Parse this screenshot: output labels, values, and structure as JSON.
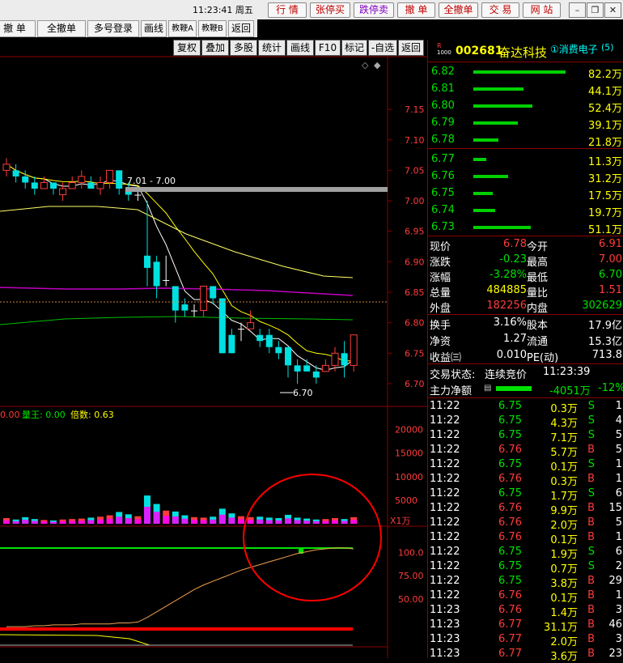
{
  "topbar": {
    "clock": "11:23:41 周五",
    "buttons": [
      "行 情",
      "张停买",
      "跌停卖",
      "撤 单",
      "全撤单",
      "交 易",
      "网 站"
    ],
    "window_controls": [
      "minimize",
      "restore",
      "close"
    ]
  },
  "toolbar1": [
    "撤 单",
    "全撤单",
    "多号登录",
    "画线",
    "教鞭A",
    "教鞭B",
    "返回"
  ],
  "toolbar2": [
    "复权",
    "叠加",
    "多股",
    "统计",
    "画线",
    "F10",
    "标记",
    "-自选",
    "返回"
  ],
  "colors": {
    "up": "#ff3b3b",
    "down": "#00e000",
    "accent_bg": "#000000",
    "frame": "#8b0000"
  },
  "stock": {
    "badge_top": "R",
    "badge_bottom": "1000",
    "code": "002681",
    "name": "奋达科技",
    "concept": "①消费电子",
    "concept_count": "(5)"
  },
  "price_axis": [
    "7.15",
    "7.10",
    "7.05",
    "7.00",
    "6.95",
    "6.90",
    "6.85",
    "6.80",
    "6.75",
    "6.70"
  ],
  "annot_range": "7.01 - 7.00",
  "annot_low": "6.70",
  "volume_label": {
    "prefix": "0.00",
    "v1_label": "量王: 0.00",
    "v2_label": "倍数: 0.63"
  },
  "volume_axis": [
    "20000",
    "15000",
    "10000",
    "5000",
    "X1万"
  ],
  "indicator_axis": [
    "100.0",
    "75.00",
    "50.00"
  ],
  "asks": [
    {
      "price": "6.82",
      "vol": "82.2万",
      "bar": 1.0
    },
    {
      "price": "6.81",
      "vol": "44.1万",
      "bar": 0.54
    },
    {
      "price": "6.80",
      "vol": "52.4万",
      "bar": 0.64
    },
    {
      "price": "6.79",
      "vol": "39.1万",
      "bar": 0.48
    },
    {
      "price": "6.78",
      "vol": "21.8万",
      "bar": 0.27
    }
  ],
  "bids": [
    {
      "price": "6.77",
      "vol": "11.3万",
      "bar": 0.14
    },
    {
      "price": "6.76",
      "vol": "31.2万",
      "bar": 0.38
    },
    {
      "price": "6.75",
      "vol": "17.5万",
      "bar": 0.21
    },
    {
      "price": "6.74",
      "vol": "19.7万",
      "bar": 0.24
    },
    {
      "price": "6.73",
      "vol": "51.1万",
      "bar": 0.62
    }
  ],
  "quote": [
    {
      "l1": "现价",
      "v1": "6.78",
      "c1": "red",
      "l2": "今开",
      "v2": "6.91",
      "c2": "red"
    },
    {
      "l1": "涨跌",
      "v1": "-0.23",
      "c1": "green",
      "l2": "最高",
      "v2": "7.00",
      "c2": "red"
    },
    {
      "l1": "涨幅",
      "v1": "-3.28%",
      "c1": "green",
      "l2": "最低",
      "v2": "6.70",
      "c2": "green"
    },
    {
      "l1": "总量",
      "v1": "484885",
      "c1": "yellow",
      "l2": "量比",
      "v2": "1.51",
      "c2": "red"
    },
    {
      "l1": "外盘",
      "v1": "182256",
      "c1": "red",
      "l2": "内盘",
      "v2": "302629",
      "c2": "green"
    }
  ],
  "fund": [
    {
      "l1": "换手",
      "v1": "3.16%",
      "l2": "股本",
      "v2": "17.9亿"
    },
    {
      "l1": "净资",
      "v1": "1.27",
      "l2": "流通",
      "v2": "15.3亿"
    },
    {
      "l1": "收益㈢",
      "v1": "0.010",
      "l2": "PE(动)",
      "v2": "713.8"
    }
  ],
  "trade_status": {
    "label": "交易状态:",
    "value": "连续竞价",
    "time": "11:23:39"
  },
  "main_flow": {
    "label": "主力净额",
    "value": "-4051万",
    "pct": "-12%"
  },
  "ticks": [
    {
      "t": "11:22",
      "p": "6.75",
      "v": "0.3万",
      "s": "S",
      "n": "1"
    },
    {
      "t": "11:22",
      "p": "6.75",
      "v": "4.3万",
      "s": "S",
      "n": "4"
    },
    {
      "t": "11:22",
      "p": "6.75",
      "v": "7.1万",
      "s": "S",
      "n": "5"
    },
    {
      "t": "11:22",
      "p": "6.76",
      "v": "5.7万",
      "s": "B",
      "n": "5"
    },
    {
      "t": "11:22",
      "p": "6.75",
      "v": "0.1万",
      "s": "S",
      "n": "1"
    },
    {
      "t": "11:22",
      "p": "6.76",
      "v": "0.3万",
      "s": "B",
      "n": "1"
    },
    {
      "t": "11:22",
      "p": "6.75",
      "v": "1.7万",
      "s": "S",
      "n": "6"
    },
    {
      "t": "11:22",
      "p": "6.76",
      "v": "9.9万",
      "s": "B",
      "n": "15"
    },
    {
      "t": "11:22",
      "p": "6.76",
      "v": "2.0万",
      "s": "B",
      "n": "5"
    },
    {
      "t": "11:22",
      "p": "6.76",
      "v": "0.1万",
      "s": "B",
      "n": "1"
    },
    {
      "t": "11:22",
      "p": "6.75",
      "v": "1.9万",
      "s": "S",
      "n": "6"
    },
    {
      "t": "11:22",
      "p": "6.75",
      "v": "0.7万",
      "s": "S",
      "n": "2"
    },
    {
      "t": "11:22",
      "p": "6.75",
      "v": "3.8万",
      "s": "B",
      "n": "29"
    },
    {
      "t": "11:22",
      "p": "6.76",
      "v": "0.1万",
      "s": "B",
      "n": "1"
    },
    {
      "t": "11:23",
      "p": "6.76",
      "v": "1.4万",
      "s": "B",
      "n": "3"
    },
    {
      "t": "11:23",
      "p": "6.77",
      "v": "31.1万",
      "s": "B",
      "n": "46"
    },
    {
      "t": "11:23",
      "p": "6.77",
      "v": "2.0万",
      "s": "B",
      "n": "3"
    },
    {
      "t": "11:23",
      "p": "6.77",
      "v": "3.6万",
      "s": "B",
      "n": "23"
    }
  ],
  "chart_data": {
    "type": "candlestick",
    "ylim": [
      6.68,
      7.19
    ],
    "candles": [
      {
        "o": 7.05,
        "c": 7.06,
        "h": 7.07,
        "l": 7.04
      },
      {
        "o": 7.05,
        "c": 7.04,
        "h": 7.06,
        "l": 7.03
      },
      {
        "o": 7.04,
        "c": 7.03,
        "h": 7.05,
        "l": 7.02
      },
      {
        "o": 7.03,
        "c": 7.02,
        "h": 7.04,
        "l": 7.01
      },
      {
        "o": 7.02,
        "c": 7.03,
        "h": 7.04,
        "l": 7.02
      },
      {
        "o": 7.03,
        "c": 7.02,
        "h": 7.03,
        "l": 7.01
      },
      {
        "o": 7.01,
        "c": 7.02,
        "h": 7.03,
        "l": 7.0
      },
      {
        "o": 7.02,
        "c": 7.03,
        "h": 7.04,
        "l": 7.02
      },
      {
        "o": 7.03,
        "c": 7.04,
        "h": 7.05,
        "l": 7.02
      },
      {
        "o": 7.03,
        "c": 7.02,
        "h": 7.04,
        "l": 7.02
      },
      {
        "o": 7.02,
        "c": 7.03,
        "h": 7.04,
        "l": 7.01
      },
      {
        "o": 7.03,
        "c": 7.05,
        "h": 7.05,
        "l": 7.02
      },
      {
        "o": 7.05,
        "c": 7.02,
        "h": 7.05,
        "l": 7.01
      },
      {
        "o": 7.02,
        "c": 7.01,
        "h": 7.03,
        "l": 7.0
      },
      {
        "o": 7.01,
        "c": 7.01,
        "h": 7.02,
        "l": 7.0
      },
      {
        "o": 6.91,
        "c": 6.89,
        "h": 7.0,
        "l": 6.86
      },
      {
        "o": 6.9,
        "c": 6.86,
        "h": 6.91,
        "l": 6.84
      },
      {
        "o": 6.87,
        "c": 6.87,
        "h": 6.91,
        "l": 6.86
      },
      {
        "o": 6.86,
        "c": 6.82,
        "h": 6.86,
        "l": 6.8
      },
      {
        "o": 6.83,
        "c": 6.82,
        "h": 6.84,
        "l": 6.81
      },
      {
        "o": 6.82,
        "c": 6.82,
        "h": 6.83,
        "l": 6.81
      },
      {
        "o": 6.82,
        "c": 6.86,
        "h": 6.86,
        "l": 6.81
      },
      {
        "o": 6.86,
        "c": 6.84,
        "h": 6.86,
        "l": 6.83
      },
      {
        "o": 6.84,
        "c": 6.75,
        "h": 6.84,
        "l": 6.75
      },
      {
        "o": 6.78,
        "c": 6.75,
        "h": 6.79,
        "l": 6.75
      },
      {
        "o": 6.79,
        "c": 6.79,
        "h": 6.8,
        "l": 6.77
      },
      {
        "o": 6.79,
        "c": 6.8,
        "h": 6.82,
        "l": 6.79
      },
      {
        "o": 6.78,
        "c": 6.77,
        "h": 6.79,
        "l": 6.76
      },
      {
        "o": 6.78,
        "c": 6.76,
        "h": 6.79,
        "l": 6.75
      },
      {
        "o": 6.76,
        "c": 6.75,
        "h": 6.77,
        "l": 6.74
      },
      {
        "o": 6.76,
        "c": 6.73,
        "h": 6.76,
        "l": 6.71
      },
      {
        "o": 6.73,
        "c": 6.72,
        "h": 6.74,
        "l": 6.7
      },
      {
        "o": 6.73,
        "c": 6.72,
        "h": 6.74,
        "l": 6.72
      },
      {
        "o": 6.72,
        "c": 6.71,
        "h": 6.73,
        "l": 6.7
      },
      {
        "o": 6.72,
        "c": 6.73,
        "h": 6.74,
        "l": 6.72
      },
      {
        "o": 6.73,
        "c": 6.75,
        "h": 6.76,
        "l": 6.72
      },
      {
        "o": 6.75,
        "c": 6.73,
        "h": 6.77,
        "l": 6.71
      },
      {
        "o": 6.73,
        "c": 6.78,
        "h": 6.78,
        "l": 6.72
      }
    ],
    "volume_max": 22000,
    "volumes": [
      1200,
      900,
      1400,
      1000,
      800,
      700,
      900,
      1000,
      1100,
      1300,
      1500,
      1800,
      2500,
      2000,
      1600,
      6000,
      4200,
      2800,
      2600,
      1800,
      1400,
      1300,
      1500,
      3200,
      2200,
      1600,
      1400,
      1500,
      1300,
      1200,
      1900,
      1300,
      1100,
      900,
      1000,
      1200,
      1000,
      1400
    ],
    "indicator_ylim": [
      0,
      125
    ],
    "indicator_line": [
      20,
      20,
      20,
      21,
      21,
      22,
      22,
      22,
      23,
      23,
      23,
      23,
      24,
      24,
      25,
      30,
      36,
      42,
      48,
      54,
      60,
      65,
      69,
      73,
      77,
      81,
      84,
      87,
      90,
      93,
      96,
      99,
      101,
      103,
      104,
      105,
      105,
      104
    ]
  }
}
